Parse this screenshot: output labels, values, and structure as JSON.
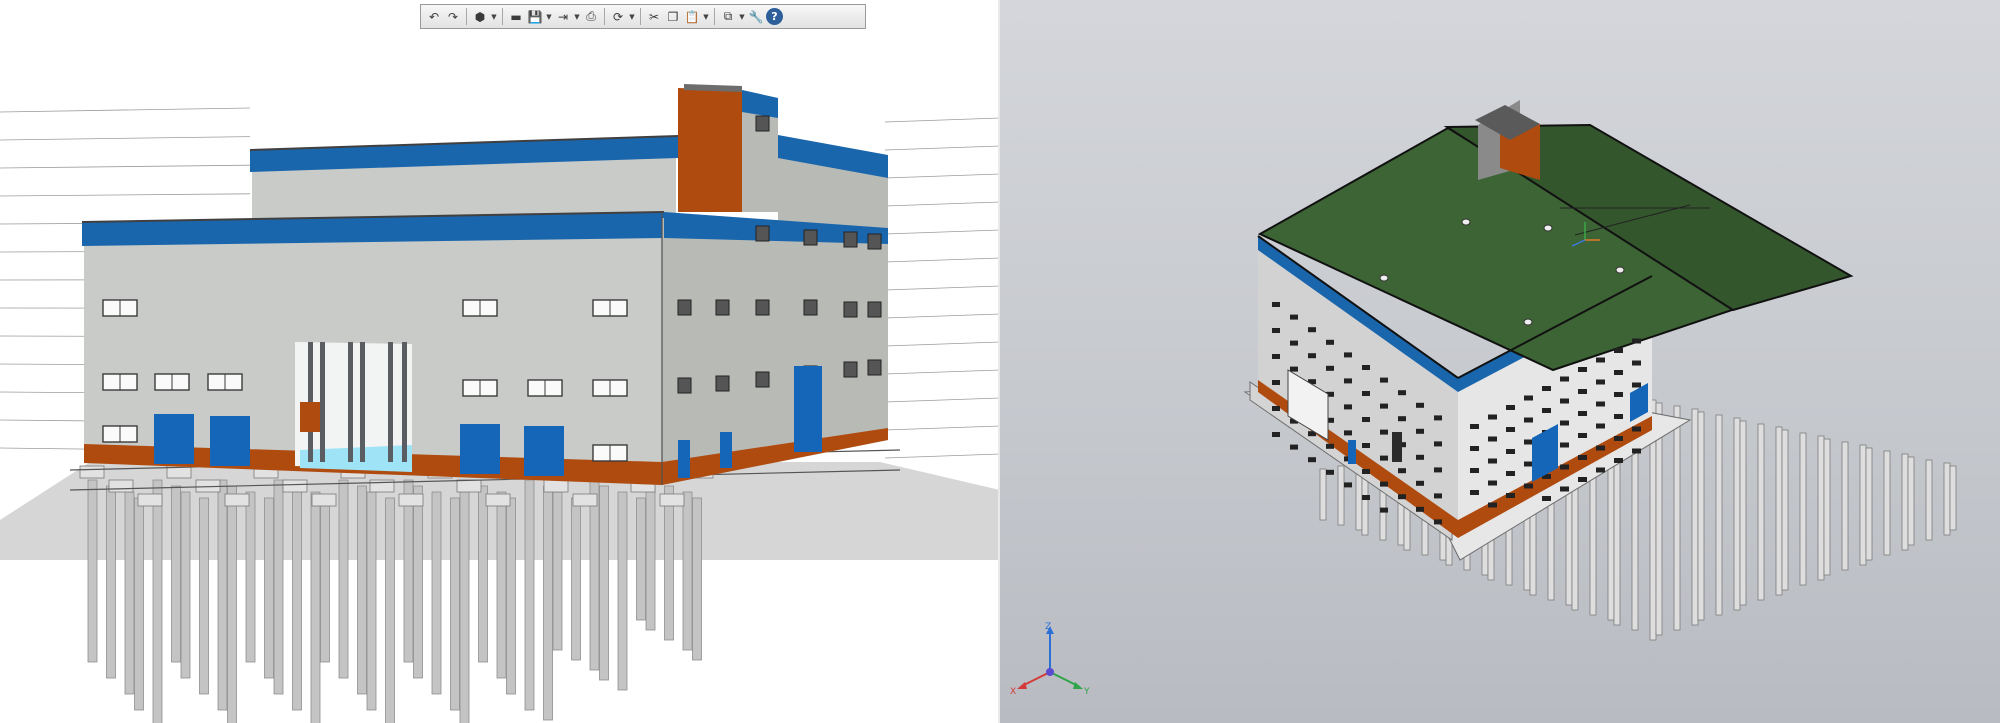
{
  "left_viewport": {
    "toolbar": {
      "buttons": [
        {
          "name": "undo-button",
          "icon": "undo-icon",
          "glyph": "↶",
          "dropdown": false
        },
        {
          "name": "redo-button",
          "icon": "redo-icon",
          "glyph": "↷",
          "dropdown": false
        },
        {
          "sep": true
        },
        {
          "name": "view-cube-button",
          "icon": "view-cube-icon",
          "glyph": "⬢",
          "dropdown": true
        },
        {
          "sep": true
        },
        {
          "name": "open-button",
          "icon": "folder-icon",
          "glyph": "▬",
          "dropdown": false
        },
        {
          "name": "save-button",
          "icon": "save-icon",
          "glyph": "💾",
          "dropdown": true
        },
        {
          "name": "export-button",
          "icon": "export-icon",
          "glyph": "⇥",
          "dropdown": true
        },
        {
          "name": "print-button",
          "icon": "printer-icon",
          "glyph": "⎙",
          "dropdown": false
        },
        {
          "sep": true
        },
        {
          "name": "orbit-button",
          "icon": "orbit-icon",
          "glyph": "⟳",
          "dropdown": true
        },
        {
          "sep": true
        },
        {
          "name": "cut-button",
          "icon": "scissors-icon",
          "glyph": "✂",
          "dropdown": false
        },
        {
          "name": "copy-button",
          "icon": "copy-icon",
          "glyph": "❐",
          "dropdown": false
        },
        {
          "name": "paste-button",
          "icon": "clipboard-icon",
          "glyph": "📋",
          "dropdown": true
        },
        {
          "sep": true
        },
        {
          "name": "display-mode-button",
          "icon": "layers-icon",
          "glyph": "⧉",
          "dropdown": true
        },
        {
          "name": "settings-button",
          "icon": "wrench-icon",
          "glyph": "🔧",
          "dropdown": false
        },
        {
          "name": "help-button",
          "icon": "help-icon",
          "glyph": "?",
          "dropdown": false,
          "help": true
        }
      ]
    }
  },
  "right_viewport": {
    "toolbar": {
      "buttons": [
        {
          "name": "menu-button",
          "icon": "list-icon",
          "glyph": "☰",
          "dropdown": false
        },
        {
          "name": "zoom-fit-button",
          "icon": "zoom-fit-icon",
          "glyph": "⛶",
          "dropdown": false
        },
        {
          "name": "zoom-window-button",
          "icon": "zoom-window-icon",
          "glyph": "⊡",
          "dropdown": false
        },
        {
          "name": "zoom-button",
          "icon": "magnifier-icon",
          "glyph": "🔍",
          "dropdown": true
        },
        {
          "name": "pan-button",
          "icon": "hand-icon",
          "glyph": "✋",
          "dropdown": true
        },
        {
          "name": "orientation-button",
          "icon": "axis-icon",
          "glyph": "⊥",
          "dropdown": true
        },
        {
          "sep": true
        },
        {
          "name": "iso-view-button",
          "icon": "cube-icon",
          "glyph": "⬢",
          "dropdown": false,
          "dark": true
        },
        {
          "name": "display-style-button",
          "icon": "shaded-cube-icon",
          "glyph": "⬡",
          "dropdown": true
        },
        {
          "name": "hide-button",
          "icon": "eye-slash-icon",
          "glyph": "⊘",
          "dropdown": true
        },
        {
          "name": "section-button",
          "icon": "section-icon",
          "glyph": "⊟",
          "dropdown": true
        },
        {
          "sep": true
        },
        {
          "name": "snap-button",
          "icon": "snap-icon",
          "glyph": "⚲",
          "dropdown": false,
          "dark": true
        },
        {
          "name": "perspective-button",
          "icon": "perspective-icon",
          "glyph": "▣",
          "dropdown": false
        },
        {
          "name": "shadow-button",
          "icon": "shadow-icon",
          "glyph": "◧",
          "dropdown": false,
          "dark": true
        },
        {
          "name": "texture-button",
          "icon": "texture-icon",
          "glyph": "◨",
          "dropdown": false
        },
        {
          "name": "filter-button",
          "icon": "filter-icon",
          "glyph": "▼",
          "dropdown": true,
          "dark": true
        },
        {
          "sep": true
        },
        {
          "name": "measure-button",
          "icon": "measure-icon",
          "glyph": "⚒",
          "dropdown": false
        },
        {
          "name": "properties-button",
          "icon": "pen-icon",
          "glyph": "✎",
          "dropdown": false
        }
      ]
    },
    "triad": {
      "x_label": "X",
      "y_label": "Y",
      "z_label": "Z"
    }
  },
  "colors": {
    "wall": "#c9cbc8",
    "wall_side": "#b8bab6",
    "stripe": "#1a66ad",
    "orange": "#b04b10",
    "roof": "#3d6434",
    "roof_dark": "#34562d",
    "pile": "#c4c4c4",
    "glass": "#9fe4f6",
    "door": "#1565b8"
  }
}
